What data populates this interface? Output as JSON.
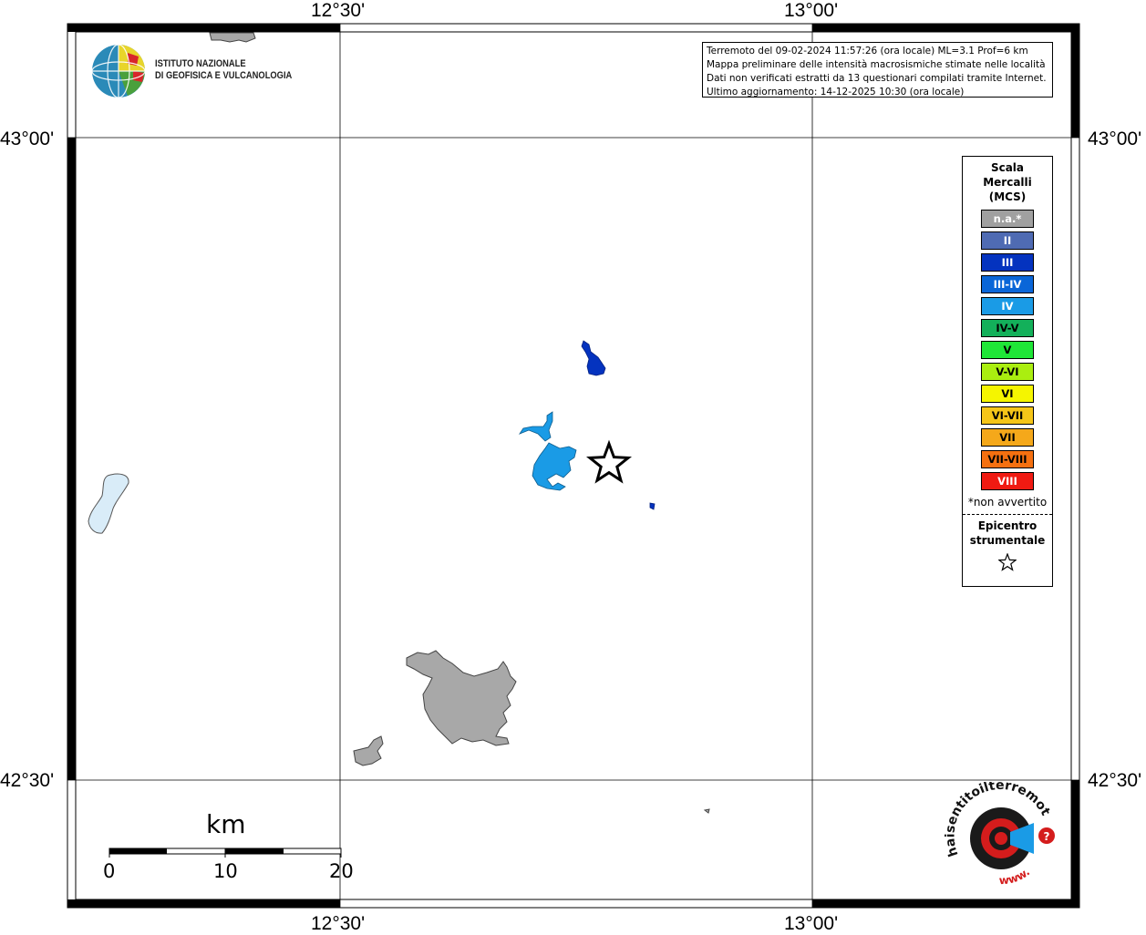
{
  "map": {
    "axes": {
      "top_lon": [
        "12°30'",
        "13°00'"
      ],
      "bottom_lon": [
        "12°30'",
        "13°00'"
      ],
      "left_lat": [
        "43°00'",
        "42°30'"
      ],
      "right_lat": [
        "43°00'",
        "42°30'"
      ]
    },
    "info_lines": [
      "Terremoto del 09-02-2024 11:57:26 (ora locale) ML=3.1 Prof=6 km",
      "Mappa preliminare delle intensità macrosismiche stimate nelle località",
      "Dati non verificati estratti da 13 questionari compilati tramite Internet.",
      "Ultimo aggiornamento: 14-12-2025 10:30 (ora locale)"
    ],
    "logo_ingv": {
      "icon": "ingv-globe-logo",
      "line1": "ISTITUTO NAZIONALE",
      "line2": "DI GEOFISICA E VULCANOLOGIA"
    },
    "legend": {
      "title_lines": [
        "Scala",
        "Mercalli",
        "(MCS)"
      ],
      "items": [
        {
          "label": "n.a.*",
          "color": "#a0a0a0"
        },
        {
          "label": "II",
          "color": "#4f6bb3"
        },
        {
          "label": "III",
          "color": "#0433bf"
        },
        {
          "label": "III-IV",
          "color": "#0a66d8"
        },
        {
          "label": "IV",
          "color": "#1a9be6"
        },
        {
          "label": "IV-V",
          "color": "#13b05a"
        },
        {
          "label": "V",
          "color": "#1fe637"
        },
        {
          "label": "V-VI",
          "color": "#aaee10"
        },
        {
          "label": "VI",
          "color": "#f5f500"
        },
        {
          "label": "VI-VII",
          "color": "#f5c518"
        },
        {
          "label": "VII",
          "color": "#f5a81a"
        },
        {
          "label": "VII-VIII",
          "color": "#f57010"
        },
        {
          "label": "VIII",
          "color": "#f01a12"
        }
      ],
      "note": "*non avvertito",
      "epicenter_lines": [
        "Epicentro",
        "strumentale"
      ],
      "epicenter_icon": "star-outline-icon"
    },
    "scale_bar": {
      "unit": "km",
      "ticks": [
        "0",
        "10",
        "20"
      ]
    },
    "features": {
      "epicenter_icon": "star-outline-icon",
      "lake_color": "#d9ecf8",
      "city_color": "#a8a8a8"
    },
    "logo_hsi": {
      "text_top": "haisentitoilterremoto.it",
      "text_url": "www."
    }
  }
}
